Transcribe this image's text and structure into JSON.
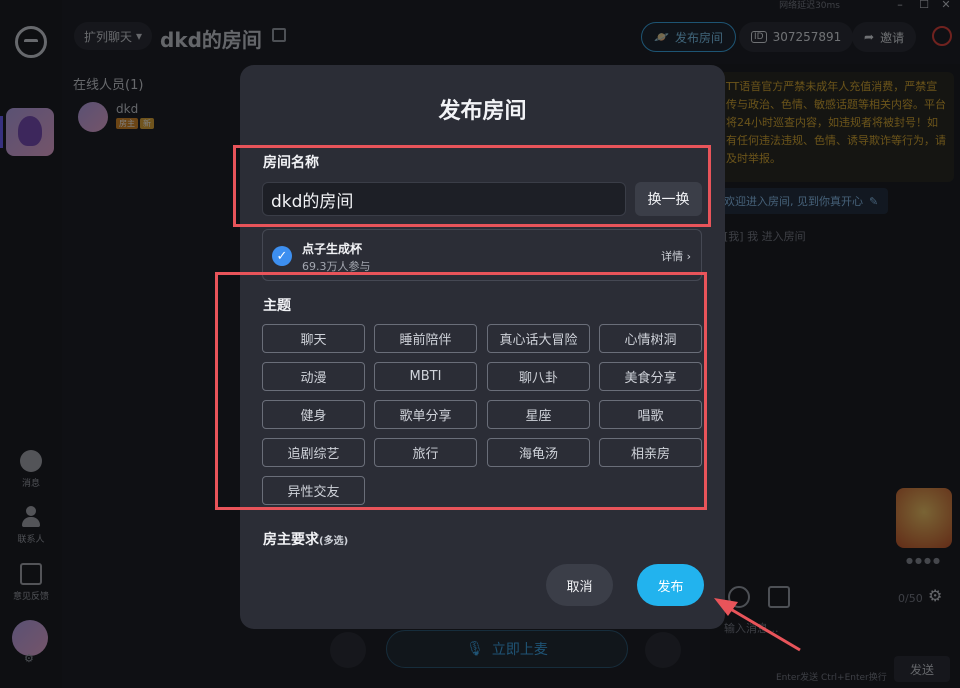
{
  "window": {
    "net_status": "网络延迟30ms",
    "min": "–",
    "max": "☐",
    "close": "✕"
  },
  "rail": {
    "items": [
      {
        "label": "消息",
        "icon": "message-icon"
      },
      {
        "label": "联系人",
        "icon": "contacts-icon"
      },
      {
        "label": "意见反馈",
        "icon": "feedback-icon"
      }
    ]
  },
  "header": {
    "sort_label": "扩列聊天",
    "room_title": "dkd的房间",
    "publish_label": "发布房间",
    "id_badge": "ID",
    "room_id": "307257891",
    "invite_label": "邀请"
  },
  "members": {
    "title": "在线人员(1)",
    "list": [
      {
        "name": "dkd",
        "tag_owner": "房主",
        "tag_level": "新"
      }
    ]
  },
  "controls": {
    "speak_label": "立即上麦"
  },
  "chat": {
    "notice": "TT语音官方严禁未成年人充值消费，严禁宣传与政治、色情、敏感话题等相关内容。平台将24小时巡查内容，如违规者将被封号！如有任何违法违规、色情、诱导欺诈等行为，请及时举报。",
    "welcome": "欢迎进入房间, 见到你真开心",
    "entered": "[我] 我 进入房间",
    "counter": "0/50",
    "input_placeholder": "输入消息...",
    "send_hint": "Enter发送 Ctrl+Enter换行",
    "send_label": "发送"
  },
  "modal": {
    "title": "发布房间",
    "room_name_label": "房间名称",
    "room_name_value": "dkd的房间",
    "swap_label": "换一换",
    "cup_name": "点子生成杯",
    "cup_count": "69.3万人参与",
    "cup_detail": "详情 ›",
    "topic_label": "主题",
    "topics": [
      "聊天",
      "睡前陪伴",
      "真心话大冒险",
      "心情树洞",
      "动漫",
      "MBTI",
      "聊八卦",
      "美食分享",
      "健身",
      "歌单分享",
      "星座",
      "唱歌",
      "追剧综艺",
      "旅行",
      "海龟汤",
      "相亲房",
      "异性交友"
    ],
    "host_label": "房主要求",
    "host_hint": "(多选)",
    "cancel_label": "取消",
    "submit_label": "发布"
  },
  "colors": {
    "accent": "#22b3ee",
    "annotation": "#e8545a",
    "check": "#3d8ff0"
  }
}
